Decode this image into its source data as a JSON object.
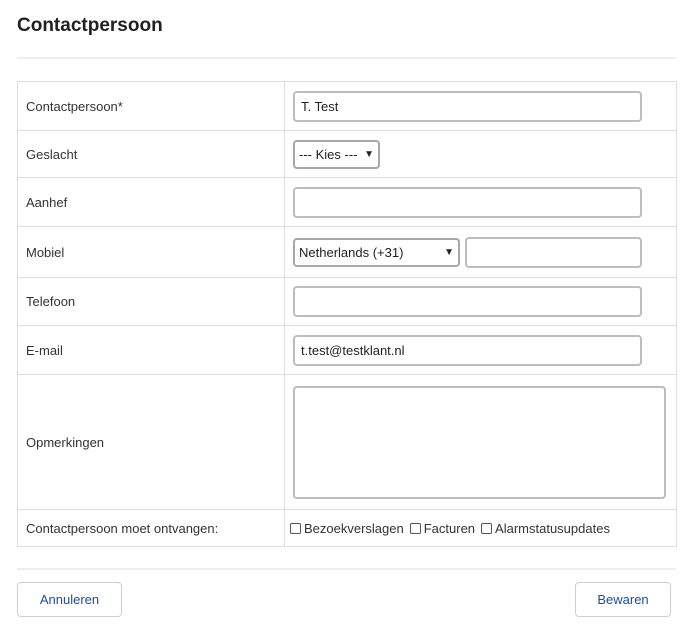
{
  "page": {
    "title": "Contactpersoon"
  },
  "form": {
    "contactpersoon": {
      "label": "Contactpersoon*",
      "value": "T. Test"
    },
    "geslacht": {
      "label": "Geslacht",
      "selected": "--- Kies ---"
    },
    "aanhef": {
      "label": "Aanhef",
      "value": ""
    },
    "mobiel": {
      "label": "Mobiel",
      "country": "Netherlands (+31)",
      "value": ""
    },
    "telefoon": {
      "label": "Telefoon",
      "value": ""
    },
    "email": {
      "label": "E-mail",
      "value": "t.test@testklant.nl"
    },
    "opmerkingen": {
      "label": "Opmerkingen",
      "value": ""
    },
    "ontvangen": {
      "label": "Contactpersoon moet ontvangen:",
      "options": [
        "Bezoekverslagen",
        "Facturen",
        "Alarmstatusupdates"
      ]
    }
  },
  "buttons": {
    "cancel": "Annuleren",
    "save": "Bewaren"
  }
}
